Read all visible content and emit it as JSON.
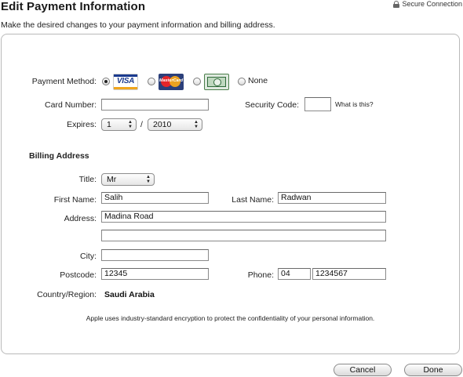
{
  "header": {
    "title": "Edit Payment Information",
    "secure_label": "Secure Connection",
    "instructions": "Make the desired changes to your payment information and billing address."
  },
  "payment": {
    "method_label": "Payment Method:",
    "cards": [
      "VISA",
      "MasterCard",
      "American Express"
    ],
    "none_label": "None",
    "selected": "VISA",
    "card_number_label": "Card Number:",
    "card_number_value": "",
    "security_code_label": "Security Code:",
    "security_code_value": "",
    "whats_this": "What is this?",
    "expires_label": "Expires:",
    "expires_month": "1",
    "expires_sep": "/",
    "expires_year": "2010"
  },
  "billing": {
    "heading": "Billing Address",
    "title_label": "Title:",
    "title_value": "Mr",
    "first_name_label": "First Name:",
    "first_name_value": "Salih",
    "last_name_label": "Last Name:",
    "last_name_value": "Radwan",
    "address_label": "Address:",
    "address_line1": "Madina Road",
    "address_line2": "",
    "city_label": "City:",
    "city_value": "",
    "postcode_label": "Postcode:",
    "postcode_value": "12345",
    "phone_label": "Phone:",
    "phone_area": "04",
    "phone_number": "1234567",
    "country_label": "Country/Region:",
    "country_value": "Saudi Arabia"
  },
  "encryption_note": "Apple uses industry-standard encryption to protect the confidentiality of your personal information.",
  "buttons": {
    "cancel": "Cancel",
    "done": "Done"
  }
}
